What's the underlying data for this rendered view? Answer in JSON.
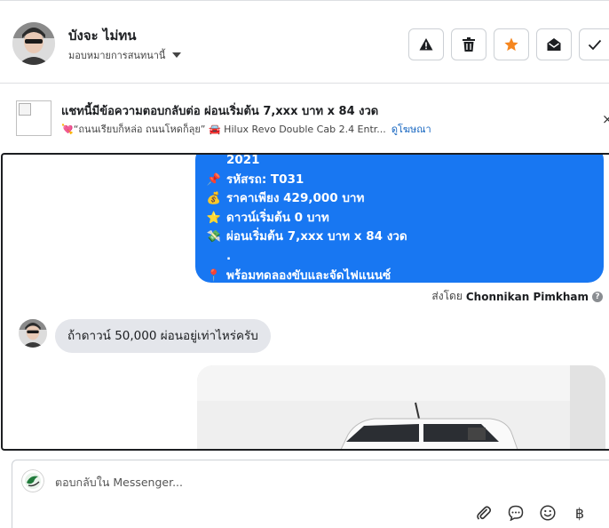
{
  "header": {
    "contact_name": "บังจะ ไม่ทน",
    "assign_label": "มอบหมายการสนทนานี้",
    "actions": [
      {
        "name": "spam-button",
        "icon": "warning-icon"
      },
      {
        "name": "delete-button",
        "icon": "trash-icon"
      },
      {
        "name": "star-button",
        "icon": "star-icon",
        "color": "#f5861f"
      },
      {
        "name": "mark-unread-button",
        "icon": "envelope-open-icon"
      },
      {
        "name": "done-button",
        "icon": "check-icon"
      }
    ]
  },
  "ad": {
    "title": "แชทนี้มีข้อความตอบกลับต่อ ผ่อนเริ่มต้น 7,xxx บาท x 84 งวด",
    "subtitle_text": "💘“ถนนเรียบก็หล่อ ถนนโหดก็ลุย” 🚘 Hilux Revo Double Cab 2.4 Entr...",
    "link_label": "ดูโฆษณา",
    "close_label": "×"
  },
  "conversation": {
    "outgoing_lines": [
      {
        "emoji": "",
        "text": "2021"
      },
      {
        "emoji": "📌",
        "text": "รหัสรถ: T031"
      },
      {
        "emoji": "💰",
        "text": "ราคาเพียง 429,000 บาท"
      },
      {
        "emoji": "⭐",
        "text": "ดาวน์เริ่มต้น 0 บาท"
      },
      {
        "emoji": "💸",
        "text": "ผ่อนเริ่มต้น 7,xxx บาท x 84 งวด"
      },
      {
        "emoji": "",
        "text": "."
      },
      {
        "emoji": "📍",
        "text": "พร้อมทดลองขับและจัดไฟแนนซ์"
      }
    ],
    "sent_by_prefix": "ส่งโดย",
    "sent_by_name": "Chonnikan Pimkham",
    "help_glyph": "?",
    "incoming_message": "ถ้าดาวน์ 50,000 ผ่อนอยู่เท่าไหร่ครับ"
  },
  "composer": {
    "placeholder": "ตอบกลับใน Messenger...",
    "tools": [
      "attach-icon",
      "chat-bubble-icon",
      "emoji-icon",
      "baht-icon"
    ],
    "baht_glyph": "฿"
  },
  "colors": {
    "accent_blue": "#1877f2",
    "incoming_bubble": "#e4e6eb",
    "star": "#f5861f",
    "link": "#1565c0"
  }
}
